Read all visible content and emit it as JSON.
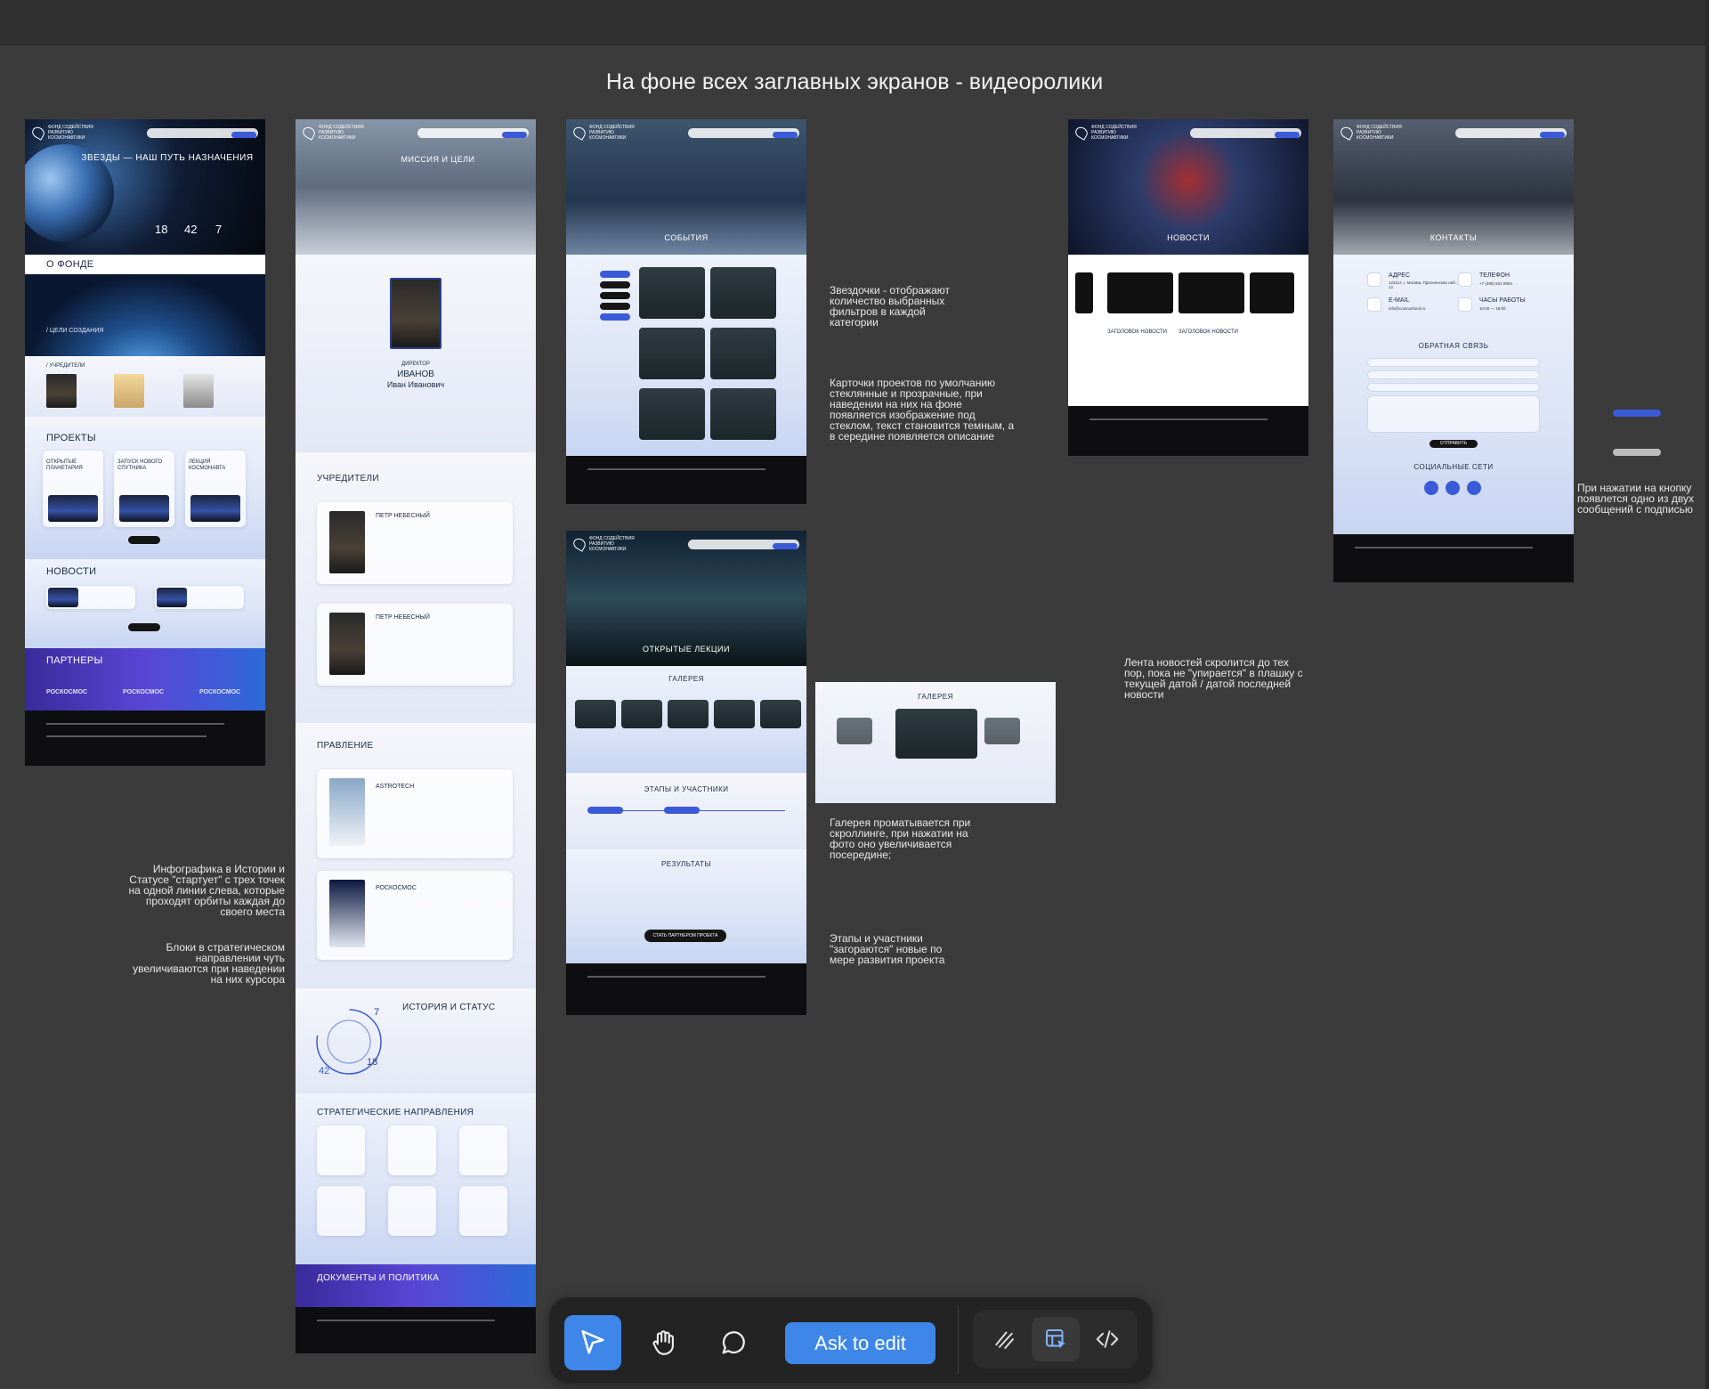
{
  "canvas": {
    "title": "На фоне всех заглавных экранов - видеоролики"
  },
  "nav": {
    "logo_text": "ФОНД СОДЕЙСТВИЯ РАЗВИТИЮ КОСМОНАВТИКИ"
  },
  "home": {
    "hero_title": "ЗВЕЗДЫ — НАШ ПУТЬ НАЗНАЧЕНИЯ",
    "stats": [
      "18",
      "42",
      "7"
    ],
    "about_title": "О ФОНДЕ",
    "goals_label": "/ ЦЕЛИ СОЗДАНИЯ",
    "founders_label": "/ УЧРЕДИТЕЛИ",
    "projects_title": "ПРОЕКТЫ",
    "projects": [
      "ОТКРЫТЫЕ ПЛАНЕТАРИЯ",
      "ЗАПУСК НОВОГО СПУТНИКА",
      "ЛЕКЦИЯ КОСМОНАВТА"
    ],
    "news_title": "НОВОСТИ",
    "partners_title": "ПАРТНЕРЫ",
    "partner_name": "РОСКОСМОС"
  },
  "about": {
    "mission_title": "МИССИЯ И ЦЕЛИ",
    "director_role": "ДИРЕКТОР",
    "director_name": "ИВАНОВ",
    "director_given": "Иван Иванович",
    "founders_title": "УЧРЕДИТЕЛИ",
    "founder_name": "ПЕТР НЕБЕСНЫЙ",
    "board_title": "ПРАВЛЕНИЕ",
    "board": [
      "ASTROTECH",
      "РОСКОСМОС"
    ],
    "history_title": "ИСТОРИЯ И СТАТУС",
    "history_stats": [
      "7",
      "42",
      "18"
    ],
    "strategy_title": "СТРАТЕГИЧЕСКИЕ НАПРАВЛЕНИЯ",
    "docs_title": "ДОКУМЕНТЫ И ПОЛИТИКА"
  },
  "events": {
    "title": "СОБЫТИЯ"
  },
  "lectures": {
    "title": "ОТКРЫТЫЕ ЛЕКЦИИ",
    "gallery_title": "ГАЛЕРЕЯ",
    "stages_title": "ЭТАПЫ И УЧАСТНИКИ",
    "results_title": "РЕЗУЛЬТАТЫ",
    "cta": "СТАТЬ ПАРТНЕРОМ ПРОЕКТА"
  },
  "gallery_zoom": {
    "title": "ГАЛЕРЕЯ"
  },
  "news": {
    "title": "НОВОСТИ",
    "item_title": "ЗАГОЛОВОК НОВОСТИ"
  },
  "contacts": {
    "title": "КОНТАКТЫ",
    "address_label": "АДРЕС",
    "address_value": "123112, г. Москва, Пресненская наб., 12",
    "phone_label": "ТЕЛЕФОН",
    "phone_value": "+7 (495) 922 8994",
    "email_label": "E-MAIL",
    "email_value": "info@cosmosfond.ru",
    "hours_label": "ЧАСЫ РАБОТЫ",
    "hours_value": "10:00 — 19:00",
    "feedback_title": "ОБРАТНАЯ СВЯЗЬ",
    "send": "ОТПРАВИТЬ",
    "social_title": "СОЦИАЛЬНЫЕ СЕТИ"
  },
  "annotations": {
    "filters": "Звездочки - отображают количество выбранных фильтров в каждой категории",
    "cards": "Карточки проектов по умолчанию стеклянные и прозрачные, при наведении на них на фоне появляется изображение под стеклом, текст становится темным, а в середине появляется описание",
    "gallery": "Галерея проматывается при скроллинге, при нажатии на фото оно увеличивается посередине;",
    "stages": "Этапы и участники \"загораются\" новые по мере развития проекта",
    "newsfeed": "Лента новостей скролится до тех пор, пока не \"упирается\" в плашку с текущей датой / датой последней новости",
    "button": "При нажатии на кнопку появлется одно из двух сообщений с подписью",
    "infographic": "Инфографика в Истории и Статусе \"стартует\" с трех точек на одной линии слева, которые проходят орбиты каждая до своего места",
    "blocks": "Блоки в стратегическом направлении чуть увеличиваются при наведении на них курсора"
  },
  "toolbar": {
    "ask_label": "Ask to edit",
    "icons": [
      "pointer-icon",
      "hand-icon",
      "comment-icon",
      "draw-icon",
      "dev-mode-icon",
      "code-icon"
    ]
  },
  "colors": {
    "accent": "#3e87e8",
    "canvas": "#3b3b3b",
    "brand_blue": "#3a5ad8"
  }
}
